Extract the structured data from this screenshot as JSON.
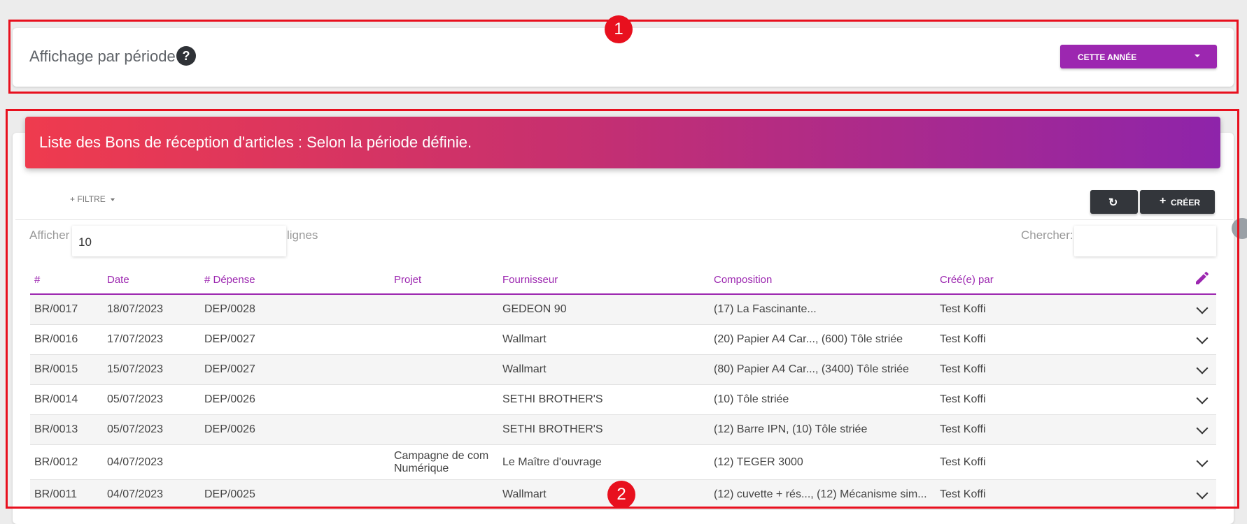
{
  "period": {
    "title": "Affichage par période",
    "help_glyph": "?",
    "select_label": "CETTE ANNÉE"
  },
  "list": {
    "banner_title": "Liste des Bons de réception d'articles : Selon la période définie.",
    "filter_label": "FILTRE",
    "create_label": "CRÉER",
    "show_label": "Afficher",
    "rows_value": "10",
    "lines_label": "lignes",
    "search_label": "Chercher:",
    "search_value": "",
    "columns": [
      "#",
      "Date",
      "# Dépense",
      "Projet",
      "Fournisseur",
      "Composition",
      "Créé(e) par"
    ],
    "rows": [
      {
        "id": "BR/0017",
        "date": "18/07/2023",
        "depense": "DEP/0028",
        "projet": "",
        "fournisseur": "GEDEON 90",
        "composition": "(17) La Fascinante...",
        "cree_par": "Test Koffi"
      },
      {
        "id": "BR/0016",
        "date": "17/07/2023",
        "depense": "DEP/0027",
        "projet": "",
        "fournisseur": "Wallmart",
        "composition": "(20) Papier A4 Car..., (600) Tôle striée",
        "cree_par": "Test Koffi"
      },
      {
        "id": "BR/0015",
        "date": "15/07/2023",
        "depense": "DEP/0027",
        "projet": "",
        "fournisseur": "Wallmart",
        "composition": "(80) Papier A4 Car..., (3400) Tôle striée",
        "cree_par": "Test Koffi"
      },
      {
        "id": "BR/0014",
        "date": "05/07/2023",
        "depense": "DEP/0026",
        "projet": "",
        "fournisseur": "SETHI BROTHER'S",
        "composition": "(10) Tôle striée",
        "cree_par": "Test Koffi"
      },
      {
        "id": "BR/0013",
        "date": "05/07/2023",
        "depense": "DEP/0026",
        "projet": "",
        "fournisseur": "SETHI BROTHER'S",
        "composition": "(12) Barre IPN, (10) Tôle striée",
        "cree_par": "Test Koffi"
      },
      {
        "id": "BR/0012",
        "date": "04/07/2023",
        "depense": "",
        "projet": "Campagne de com Numérique",
        "fournisseur": "Le Maître d'ouvrage",
        "composition": "(12) TEGER 3000",
        "cree_par": "Test Koffi"
      },
      {
        "id": "BR/0011",
        "date": "04/07/2023",
        "depense": "DEP/0025",
        "projet": "",
        "fournisseur": "Wallmart",
        "composition": "(12) cuvette + rés..., (12) Mécanisme sim...",
        "cree_par": "Test Koffi"
      }
    ]
  },
  "annotations": {
    "marker_1": "1",
    "marker_2": "2"
  },
  "colors": {
    "accent": "#9c27b0",
    "banner_start": "#ef3b4e",
    "banner_end": "#8e24aa",
    "annotation": "#e8101e"
  },
  "icons": [
    "help-icon",
    "caret-down-icon",
    "plus-icon",
    "refresh-icon",
    "pencil-icon",
    "chevron-down-icon"
  ]
}
